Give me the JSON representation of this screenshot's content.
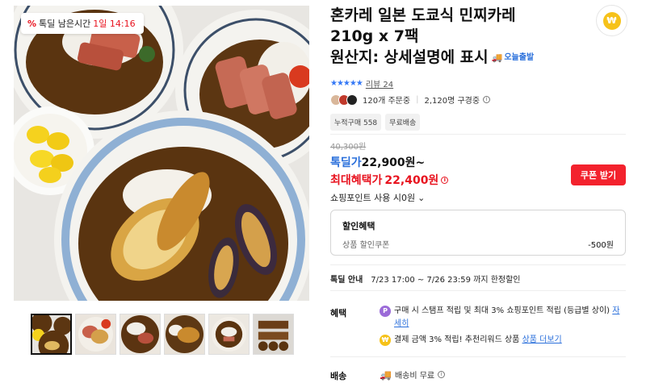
{
  "gallery": {
    "deal_timer": {
      "icon": "%",
      "label": "톡딜 남은시간",
      "time": "1일 14:16"
    },
    "thumbnail_count": 6,
    "active_thumbnail": 0
  },
  "product": {
    "title_line1": "혼카레 일본 도쿄식 민찌카레",
    "title_line2": "210g x 7팩",
    "title_line3": "원산지: 상세설명에 표시",
    "delivery_badge": "오늘출발"
  },
  "rating": {
    "stars": "★★★★★",
    "review_label": "리뷰 24"
  },
  "social": {
    "orders": "120개 주문중",
    "subscribers": "2,120명 구경중"
  },
  "tags": [
    "누적구매 558",
    "무료배송"
  ],
  "price": {
    "original": "40,300원",
    "deal_label": "톡딜가",
    "deal_value": "22,900원~",
    "max_label": "최대혜택가",
    "max_value": "22,400원",
    "coupon_button": "쿠폰 받기"
  },
  "points": {
    "label": "쇼핑포인트 사용 시0원"
  },
  "discount": {
    "header": "할인혜택",
    "row_label": "상품 할인쿠폰",
    "row_value": "-500원"
  },
  "deal_info": {
    "label": "톡딜 안내",
    "value": "7/23 17:00 ~ 7/26 23:59 까지 한정할인"
  },
  "benefits": {
    "label": "혜택",
    "item1_text": "구매 시 스탬프 적립 및 최대 3% 쇼핑포인트 적립 (등급별 상이)",
    "item1_link": "자세히",
    "item2_text": "결제 금액 3% 적립! 추천리워드 상품",
    "item2_link": "상품 더보기"
  },
  "shipping": {
    "label": "배송",
    "value": "배송비 무료"
  },
  "colors": {
    "accent_red": "#f3222d",
    "accent_blue": "#2a6fdb",
    "coin": "#f6c21a"
  }
}
